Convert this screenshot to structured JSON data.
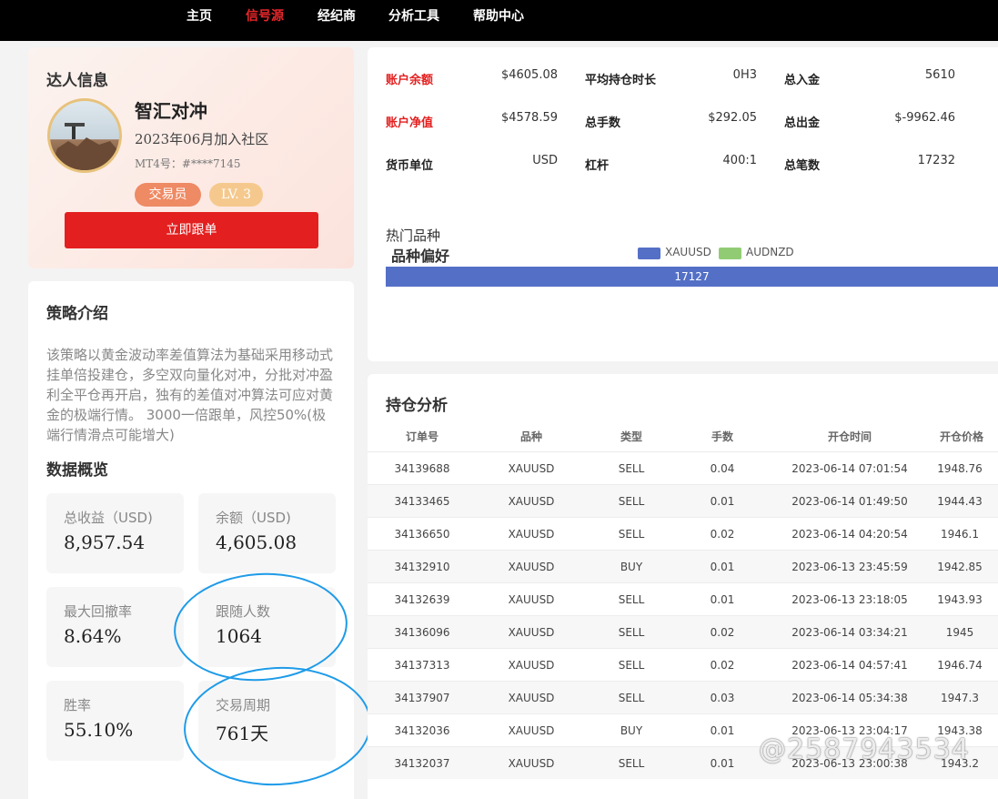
{
  "nav": {
    "items": [
      "主页",
      "信号源",
      "经纪商",
      "分析工具",
      "帮助中心"
    ],
    "active_index": 1
  },
  "profile": {
    "section_title": "达人信息",
    "name": "智汇对冲",
    "join_date": "2023年06月加入社区",
    "mt4": "MT4号：#****7145",
    "role_badge": "交易员",
    "level_badge": "LV. 3",
    "follow_button": "立即跟单"
  },
  "strategy": {
    "title": "策略介绍",
    "text": "该策略以黄金波动率差值算法为基础采用移动式挂单倍投建仓，多空双向量化对冲，分批对冲盈利全平仓再开启，独有的差值对冲算法可应对黄金的极端行情。 3000一倍跟单，风控50%(极端行情滑点可能增大)",
    "overview_title": "数据概览",
    "stats": [
      {
        "label": "总收益（USD)",
        "value": "8,957.54"
      },
      {
        "label": "余额（USD)",
        "value": "4,605.08"
      },
      {
        "label": "最大回撤率",
        "value": "8.64%"
      },
      {
        "label": "跟随人数",
        "value": "1064"
      },
      {
        "label": "胜率",
        "value": "55.10%"
      },
      {
        "label": "交易周期",
        "value": "761天"
      }
    ]
  },
  "account": {
    "fields": [
      {
        "label": "账户余额",
        "value": "$4605.08",
        "red": true
      },
      {
        "label": "平均持仓时长",
        "value": "0H3",
        "red": false
      },
      {
        "label": "总入金",
        "value": "5610",
        "red": false
      },
      {
        "label": "账户净值",
        "value": "$4578.59",
        "red": true
      },
      {
        "label": "总手数",
        "value": "$292.05",
        "red": false
      },
      {
        "label": "总出金",
        "value": "$-9962.46",
        "red": false
      },
      {
        "label": "货币单位",
        "value": "USD",
        "red": false
      },
      {
        "label": "杠杆",
        "value": "400:1",
        "red": false
      },
      {
        "label": "总笔数",
        "value": "17232",
        "red": false
      }
    ],
    "hot_label": "热门品种",
    "pref_title": "品种偏好",
    "legend": [
      {
        "name": "XAUUSD",
        "color": "#5470c6"
      },
      {
        "name": "AUDNZD",
        "color": "#91cc75"
      }
    ],
    "bar_value": "17127"
  },
  "positions": {
    "title": "持仓分析",
    "headers": [
      "订单号",
      "品种",
      "类型",
      "手数",
      "开仓时间",
      "开仓价格"
    ],
    "rows": [
      [
        "34139688",
        "XAUUSD",
        "SELL",
        "0.04",
        "2023-06-14 07:01:54",
        "1948.76"
      ],
      [
        "34133465",
        "XAUUSD",
        "SELL",
        "0.01",
        "2023-06-14 01:49:50",
        "1944.43"
      ],
      [
        "34136650",
        "XAUUSD",
        "SELL",
        "0.02",
        "2023-06-14 04:20:54",
        "1946.1"
      ],
      [
        "34132910",
        "XAUUSD",
        "BUY",
        "0.01",
        "2023-06-13 23:45:59",
        "1942.85"
      ],
      [
        "34132639",
        "XAUUSD",
        "SELL",
        "0.01",
        "2023-06-13 23:18:05",
        "1943.93"
      ],
      [
        "34136096",
        "XAUUSD",
        "SELL",
        "0.02",
        "2023-06-14 03:34:21",
        "1945"
      ],
      [
        "34137313",
        "XAUUSD",
        "SELL",
        "0.02",
        "2023-06-14 04:57:41",
        "1946.74"
      ],
      [
        "34137907",
        "XAUUSD",
        "SELL",
        "0.03",
        "2023-06-14 05:34:38",
        "1947.3"
      ],
      [
        "34132036",
        "XAUUSD",
        "BUY",
        "0.01",
        "2023-06-13 23:04:17",
        "1943.38"
      ],
      [
        "34132037",
        "XAUUSD",
        "SELL",
        "0.01",
        "2023-06-13 23:00:38",
        "1943.2"
      ]
    ]
  },
  "watermark": "@2587943534",
  "colors": {
    "accent_red": "#e41f1f",
    "nav_bg": "#000000",
    "annotation_blue": "#1f9be8"
  }
}
